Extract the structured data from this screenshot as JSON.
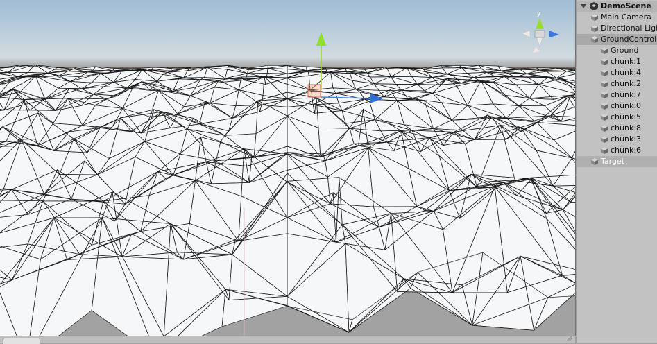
{
  "hierarchy": {
    "scene_name": "DemoScene",
    "items": [
      {
        "label": "Main Camera",
        "indent": 1,
        "kind": "go"
      },
      {
        "label": "Directional Light",
        "indent": 1,
        "kind": "go"
      },
      {
        "label": "GroundController",
        "indent": 1,
        "kind": "parent"
      },
      {
        "label": "Ground",
        "indent": 2,
        "kind": "cube"
      },
      {
        "label": "chunk:1",
        "indent": 2,
        "kind": "cube"
      },
      {
        "label": "chunk:4",
        "indent": 2,
        "kind": "cube"
      },
      {
        "label": "chunk:2",
        "indent": 2,
        "kind": "cube"
      },
      {
        "label": "chunk:7",
        "indent": 2,
        "kind": "cube"
      },
      {
        "label": "chunk:0",
        "indent": 2,
        "kind": "cube"
      },
      {
        "label": "chunk:5",
        "indent": 2,
        "kind": "cube"
      },
      {
        "label": "chunk:8",
        "indent": 2,
        "kind": "cube"
      },
      {
        "label": "chunk:3",
        "indent": 2,
        "kind": "cube"
      },
      {
        "label": "chunk:6",
        "indent": 2,
        "kind": "cube"
      },
      {
        "label": "Target",
        "indent": 1,
        "kind": "target"
      }
    ]
  },
  "gizmo": {
    "axis_colors": {
      "x": "#d6453b",
      "y": "#9adb2e",
      "z": "#3a78e0"
    }
  },
  "scene": {
    "sky_top": "#a9c4da",
    "sky_horizon": "#d4dde2",
    "ground_far": "#6b6460"
  }
}
